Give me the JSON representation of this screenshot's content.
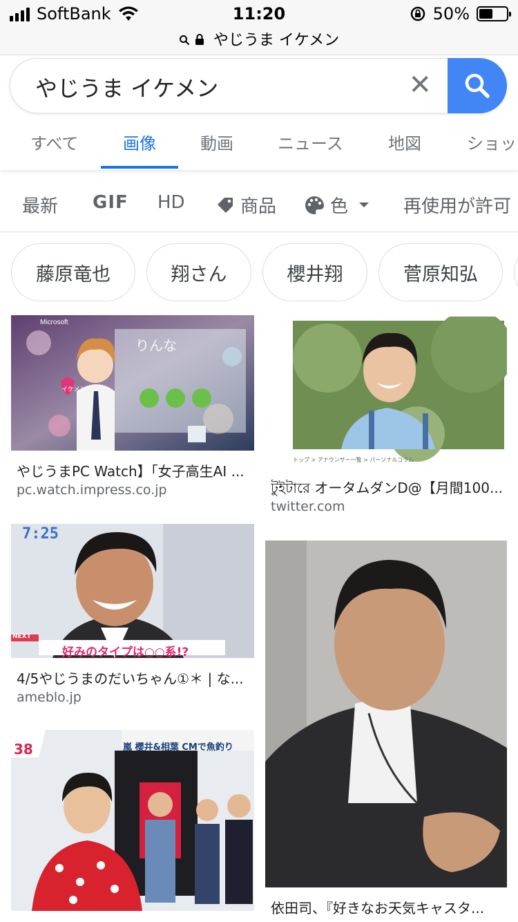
{
  "status_bar": {
    "carrier": "SoftBank",
    "time": "11:20",
    "battery": "50%"
  },
  "url_bar": {
    "text": "やじうま イケメン"
  },
  "search": {
    "query": "やじうま イケメン",
    "clear_glyph": "✕"
  },
  "tabs": [
    {
      "label": "すべて",
      "active": false
    },
    {
      "label": "画像",
      "active": true
    },
    {
      "label": "動画",
      "active": false
    },
    {
      "label": "ニュース",
      "active": false
    },
    {
      "label": "地図",
      "active": false
    },
    {
      "label": "ショッ",
      "active": false
    }
  ],
  "tools": {
    "latest": "最新",
    "gif": "GIF",
    "hd": "HD",
    "product": "商品",
    "color": "色",
    "reuse": "再使用が許可"
  },
  "chips": [
    "藤原竜也",
    "翔さん",
    "櫻井翔",
    "菅原知弘"
  ],
  "results": [
    {
      "caption": "やじうまPC Watch】「女子高生AI ...",
      "source": "pc.watch.impress.co.jp",
      "image_text": {
        "name": "りんな",
        "brand": "Microsoft",
        "badge": "イケメン"
      }
    },
    {
      "caption": "টুইটারে オータムダンD@【月間100...",
      "source": "twitter.com",
      "image_text": {
        "breadcrumb": "トップ > アナウンサー一覧 > パーソナルコラム"
      }
    },
    {
      "caption": "4/5やじうまのだいちゃん①＊ | な...",
      "source": "ameblo.jp",
      "image_text": {
        "clock": "7:25",
        "next": "NEXT",
        "telop": "好みのタイプは○○系!?"
      }
    },
    {
      "caption": "依田司、『好きなお天気キャスタ...",
      "source": ""
    },
    {
      "caption": "",
      "source": "",
      "image_text": {
        "num": "38",
        "telop": "嵐 櫻井&相葉 CMで魚釣り"
      }
    }
  ],
  "colors": {
    "accent": "#1a73e8",
    "search_button": "#4285f4"
  }
}
